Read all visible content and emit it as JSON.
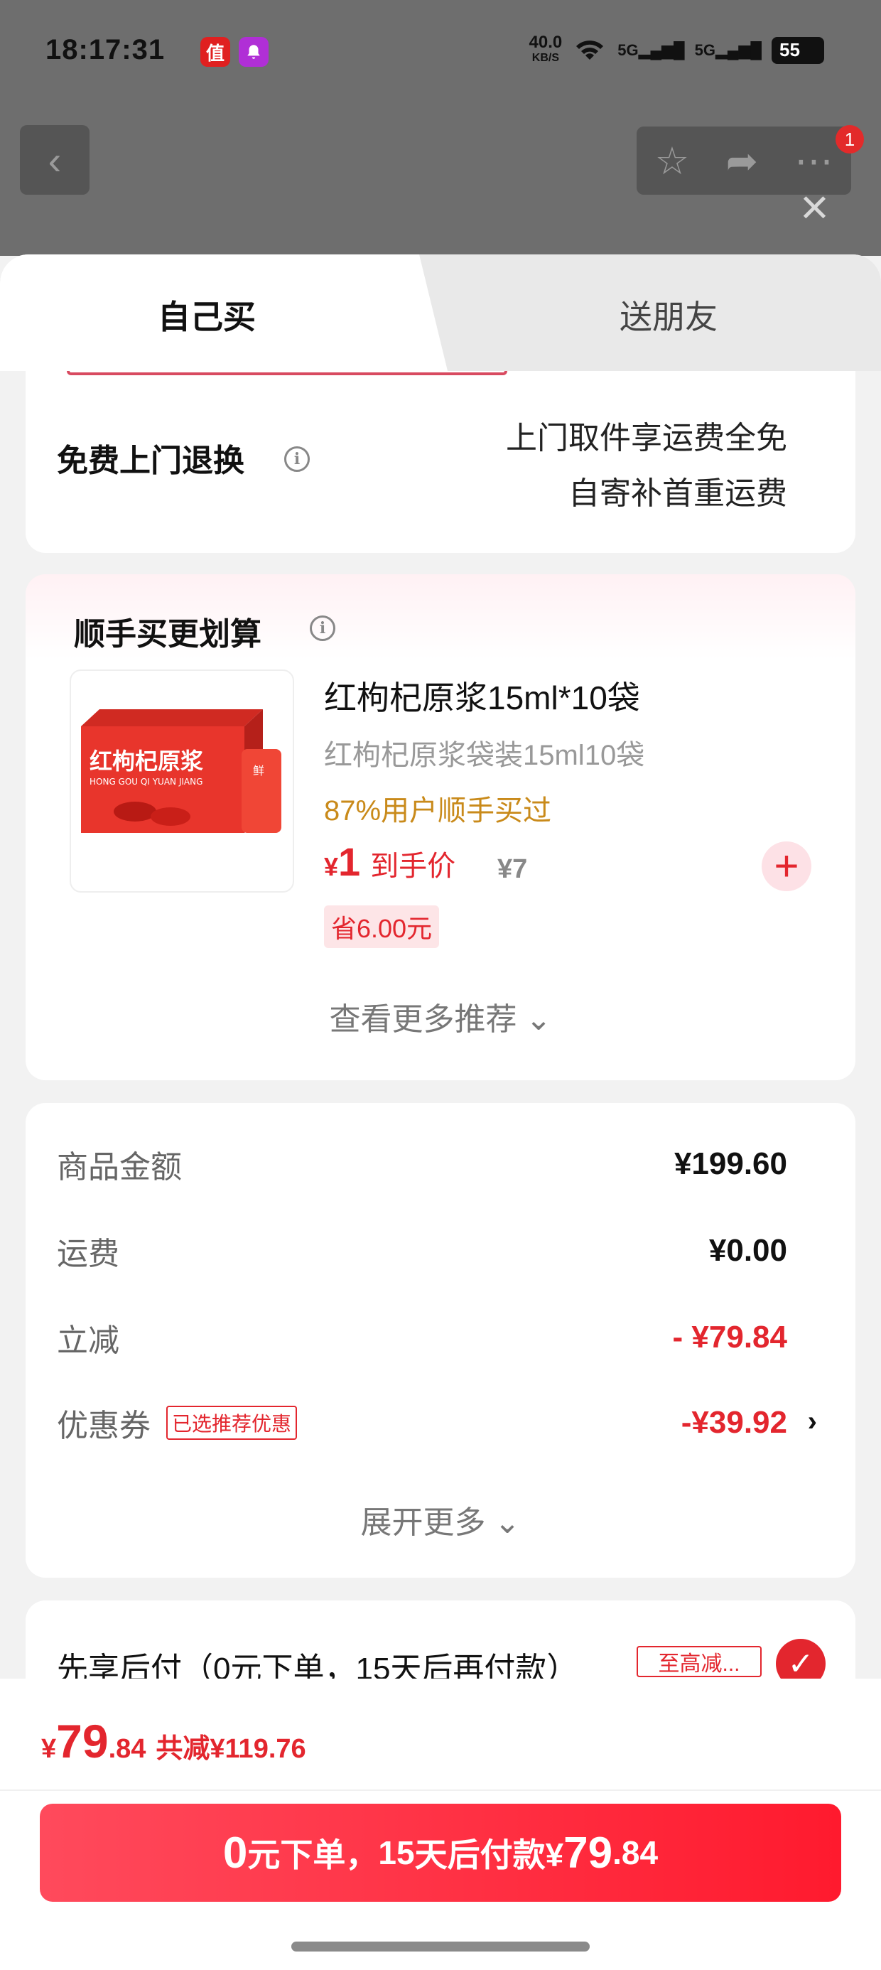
{
  "status_bar": {
    "time": "18:17:31",
    "app_icon_1": "值",
    "app_icon_2": "bell-icon",
    "net_speed": "40.0",
    "net_unit": "KB/S",
    "sig1": "5G",
    "sig2": "5G",
    "battery": "55"
  },
  "nav": {
    "badge": "1"
  },
  "tabs": {
    "self": "自己买",
    "friend": "送朋友"
  },
  "return_service": {
    "title": "免费上门退换",
    "line1": "上门取件享运费全免",
    "line2": "自寄补首重运费"
  },
  "recommend": {
    "title": "顺手买更划算",
    "product_name": "红枸杞原浆15ml*10袋",
    "product_desc": "红枸杞原浆袋装15ml10袋",
    "bought_text": "87%用户顺手买过",
    "price_currency": "¥",
    "price": "1",
    "price_label": "到手价",
    "orig_price": "¥7",
    "save": "省6.00元",
    "image_box_title": "红枸杞原浆",
    "image_box_pinyin": "HONG GOU QI YUAN JIANG",
    "image_box_bag": "鲜",
    "more": "查看更多推荐 ⌄"
  },
  "summary": {
    "goods_label": "商品金额",
    "goods_value": "¥199.60",
    "shipping_label": "运费",
    "shipping_value": "¥0.00",
    "discount_label": "立减",
    "discount_value": "- ¥79.84",
    "coupon_label": "优惠券",
    "coupon_tag": "已选推荐优惠",
    "coupon_value": "-¥39.92",
    "expand": "展开更多 ⌄"
  },
  "pay_later": {
    "text": "先享后付（0元下单，15天后再付款）",
    "tag": "至高减..."
  },
  "bottom": {
    "currency": "¥",
    "total_int": "79",
    "total_dec": ".84",
    "reduce": "共减¥119.76",
    "btn_zero": "0",
    "btn_text1": "元下单，",
    "btn_days": "15",
    "btn_text2": "天后付款¥",
    "btn_int": "79",
    "btn_dec": ".84"
  },
  "colors": {
    "accent": "#e3262e",
    "bought": "#c98a1a"
  }
}
